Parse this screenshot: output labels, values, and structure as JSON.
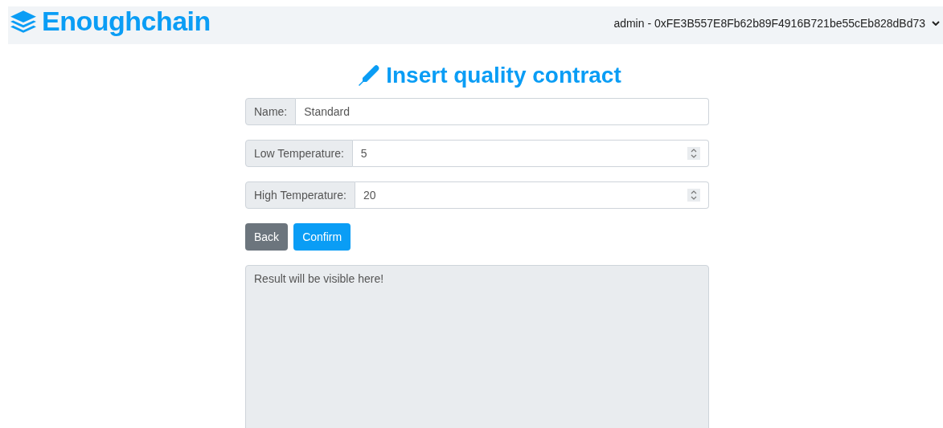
{
  "navbar": {
    "brand": "Enoughchain",
    "account": "admin - 0xFE3B557E8Fb62b89F4916B721be55cEb828dBd73"
  },
  "heading": "Insert quality contract",
  "fields": [
    {
      "label": "Name:",
      "value": "Standard",
      "kind": "text"
    },
    {
      "label": "Low Temperature:",
      "value": "5",
      "kind": "number"
    },
    {
      "label": "High Temperature:",
      "value": "20",
      "kind": "number"
    }
  ],
  "buttons": [
    {
      "label": "Back",
      "kind": "secondary"
    },
    {
      "label": "Confirm",
      "kind": "primary"
    }
  ],
  "result": {
    "placeholder": "Result will be visible here!"
  }
}
